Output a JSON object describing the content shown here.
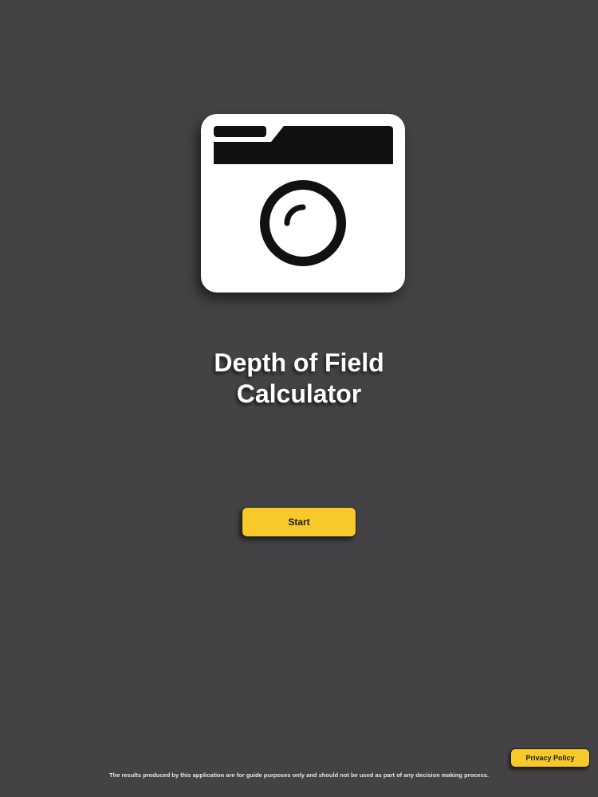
{
  "app": {
    "title_line1": "Depth of Field",
    "title_line2": "Calculator",
    "icon": "camera-icon"
  },
  "actions": {
    "start_label": "Start",
    "privacy_label": "Privacy Policy"
  },
  "footer": {
    "disclaimer": "The results produced by this application are for guide purposes only and should not be used as part of any decision making process."
  },
  "colors": {
    "background": "#444244",
    "accent": "#f7c92b",
    "icon_fill": "#ffffff",
    "icon_ink": "#111111"
  }
}
